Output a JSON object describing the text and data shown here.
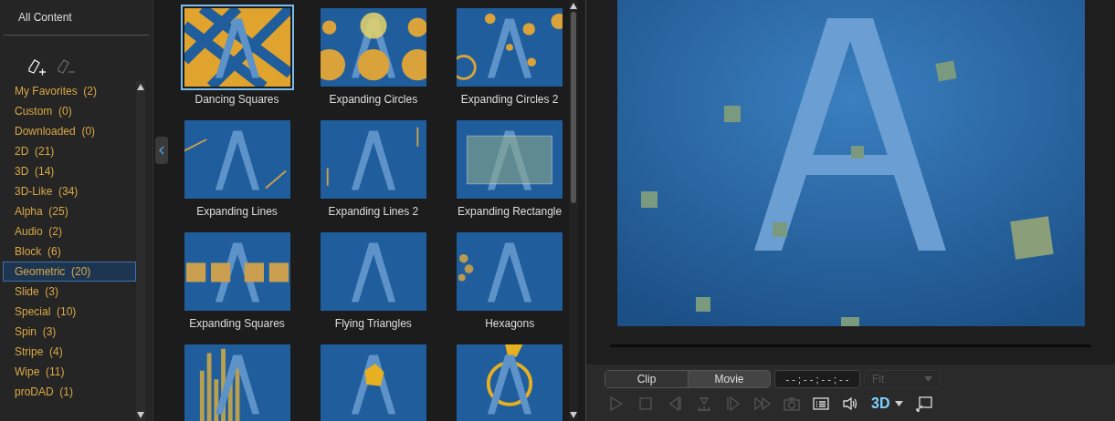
{
  "sidebar": {
    "header": "All Content",
    "categories": [
      {
        "label": "My Favorites  (2)",
        "selected": false
      },
      {
        "label": "Custom  (0)",
        "selected": false
      },
      {
        "label": "Downloaded  (0)",
        "selected": false
      },
      {
        "label": "2D  (21)",
        "selected": false
      },
      {
        "label": "3D  (14)",
        "selected": false
      },
      {
        "label": "3D-Like  (34)",
        "selected": false
      },
      {
        "label": "Alpha  (25)",
        "selected": false
      },
      {
        "label": "Audio  (2)",
        "selected": false
      },
      {
        "label": "Block  (6)",
        "selected": false
      },
      {
        "label": "Geometric  (20)",
        "selected": true
      },
      {
        "label": "Slide  (3)",
        "selected": false
      },
      {
        "label": "Special  (10)",
        "selected": false
      },
      {
        "label": "Spin  (3)",
        "selected": false
      },
      {
        "label": "Stripe  (4)",
        "selected": false
      },
      {
        "label": "Wipe  (11)",
        "selected": false
      },
      {
        "label": "proDAD  (1)",
        "selected": false
      }
    ]
  },
  "transitions": [
    {
      "label": "Dancing Squares",
      "selected": true,
      "kind": "squares"
    },
    {
      "label": "Expanding Circles",
      "selected": false,
      "kind": "circles"
    },
    {
      "label": "Expanding Circles 2",
      "selected": false,
      "kind": "circles2"
    },
    {
      "label": "Expanding Lines",
      "selected": false,
      "kind": "lines"
    },
    {
      "label": "Expanding Lines 2",
      "selected": false,
      "kind": "lines2"
    },
    {
      "label": "Expanding Rectangle",
      "selected": false,
      "kind": "rectangle"
    },
    {
      "label": "Expanding Squares",
      "selected": false,
      "kind": "squarerow"
    },
    {
      "label": "Flying Triangles",
      "selected": false,
      "kind": "plain"
    },
    {
      "label": "Hexagons",
      "selected": false,
      "kind": "hexagons"
    },
    {
      "selected": false,
      "kind": "bars"
    },
    {
      "selected": false,
      "kind": "pentagon"
    },
    {
      "selected": false,
      "kind": "ring"
    }
  ],
  "preview": {
    "modes": [
      {
        "label": "Clip",
        "selected": true
      },
      {
        "label": "Movie",
        "selected": false
      }
    ],
    "timecode": "- - ; - - ; - - ; - -",
    "zoom": {
      "value": "Fit",
      "disabled": true
    },
    "controls": [
      {
        "kind": "play",
        "disabled": true
      },
      {
        "kind": "stop",
        "disabled": true
      },
      {
        "kind": "prev",
        "disabled": true
      },
      {
        "kind": "mark",
        "disabled": true
      },
      {
        "kind": "next",
        "disabled": true
      },
      {
        "kind": "fast",
        "disabled": true
      },
      {
        "kind": "camera",
        "disabled": true
      },
      {
        "kind": "list",
        "disabled": false
      },
      {
        "kind": "volume",
        "disabled": false
      }
    ],
    "stereo_label": "3D"
  }
}
